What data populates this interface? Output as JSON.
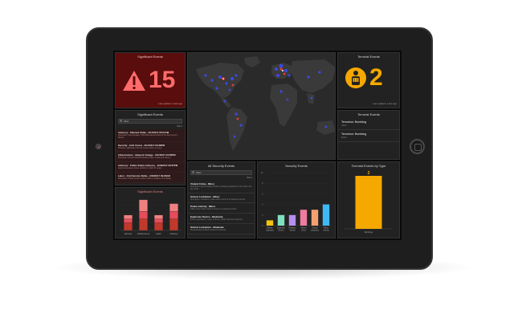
{
  "dashboard": {
    "significant_indicator": {
      "title": "Significant Events",
      "value": "15",
      "footer": "Last updated: a few ago",
      "icon": "warning-triangle-icon",
      "color": "#ff6b6b"
    },
    "terrorist_indicator": {
      "title": "Terrorist Events",
      "value": "2",
      "footer": "Last updated: a few ago",
      "icon": "bomb-person-icon",
      "color": "#f5a800"
    },
    "terrorist_list": {
      "title": "Terrorist Events",
      "items": [
        {
          "title": "Terrorism: Bombing",
          "sub": "Africa"
        },
        {
          "title": "Terrorism: Bombing",
          "sub": "Brazil"
        }
      ]
    },
    "significant_list": {
      "title": "Significant Events",
      "filter_placeholder": "Filter",
      "sort_label": "Sort ▾",
      "items": [
        {
          "title": "Advisory - Planned Strike - 3/17/2017 05:07AM",
          "desc": "Description: Approximately 1,500,000 planned strike for the days spent in Mexico"
        },
        {
          "title": "Security - Civil Unrest - 3/17/2017 03:28PM",
          "desc": "Protesters gathered in the city center, police on scene"
        },
        {
          "title": "Infrastructure - Network Outage - 3/17/2017 04:05PM",
          "desc": "Description: Recent 500,000 Muslims rallies, mobile and internet"
        },
        {
          "title": "Advisory - Public Safety Advisory - 3/16/2017 08:57PM",
          "desc": "Avoid unnecessary travel, advisory in effect for region"
        },
        {
          "title": "Labor - Civil Service Strike - 3/16/2017 09:26AM",
          "desc": "Description: Public service workers strike in advance of a holiday"
        }
      ]
    },
    "significant_chart": {
      "title": "Significant Events"
    },
    "all_security": {
      "title": "All Security Events",
      "filter_placeholder": "Filter",
      "sort_label": "Sort ▾",
      "items": [
        {
          "title": "Violent Crime - Minor",
          "desc": "Description: Approximately 20,000 of protesters gathered for the rally in the city center"
        },
        {
          "title": "School Lockdown - Minor",
          "desc": "Description: Lockdown in place after reports of a suspicious person"
        },
        {
          "title": "Police Activity - Minor",
          "desc": "Officers have had to clear an area on a reported incident"
        },
        {
          "title": "Explosive Device - Moderate",
          "desc": "Police responded to report of device, MASC has been informed"
        },
        {
          "title": "School Lockdown - Moderate",
          "desc": "Precautionary lockdown issued for students"
        }
      ]
    },
    "security_chart": {
      "title": "Security Events"
    },
    "terrorist_type": {
      "title": "Terrorist Events by Type"
    }
  },
  "chart_data": [
    {
      "type": "bar",
      "title": "Significant Events",
      "categories": [
        "Security",
        "Infrastructure",
        "Labor",
        "Advisory"
      ],
      "series": [
        {
          "values": [
            2,
            3,
            2,
            3
          ]
        },
        {
          "values": [
            1,
            2,
            1,
            2
          ]
        },
        {
          "values": [
            1,
            3,
            1,
            2
          ]
        }
      ],
      "colors": [
        "#c0392b",
        "#e74c5c",
        "#f08080"
      ],
      "stacked": true
    },
    {
      "type": "bar",
      "title": "Security Events",
      "categories": [
        "Military Operation",
        "Explosive Device",
        "Robbery Activity",
        "Violent Crime",
        "School Lockdown",
        "Police Activity"
      ],
      "values": [
        1,
        2,
        2,
        3,
        3,
        4
      ],
      "ylim": [
        0,
        10
      ],
      "colors": [
        "#f1c40f",
        "#7fe0c0",
        "#b48ef0",
        "#f07aa0",
        "#f5a070",
        "#3fb8f5"
      ]
    },
    {
      "type": "bar",
      "title": "Terrorist Events by Type",
      "categories": [
        "Bombing"
      ],
      "values": [
        2
      ],
      "data_labels": [
        "2"
      ],
      "colors": [
        "#f5a800"
      ]
    }
  ]
}
